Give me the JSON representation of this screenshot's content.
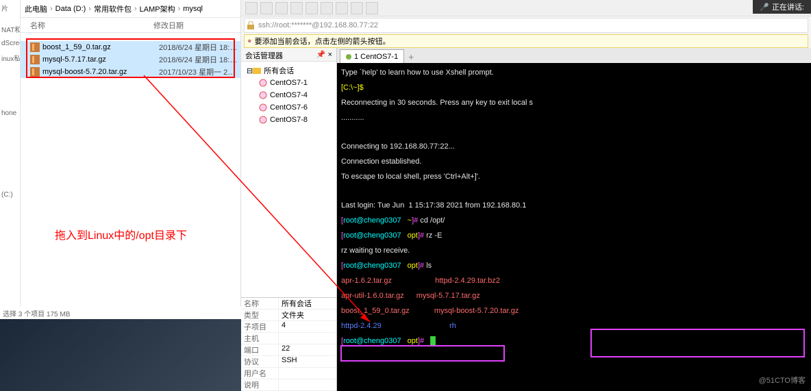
{
  "explorer": {
    "breadcrumb": [
      "此电脑",
      "Data (D:)",
      "常用软件包",
      "LAMP架构",
      "mysql"
    ],
    "header": {
      "name": "名称",
      "date": "修改日期"
    },
    "sidebar_items": [
      "片",
      "NAT和I",
      "dScree",
      "inux私房",
      "",
      "",
      "",
      "hone",
      "",
      "",
      "(C:)"
    ],
    "files": [
      {
        "name": "boost_1_59_0.tar.gz",
        "date": "2018/6/24 星期日 18:…"
      },
      {
        "name": "mysql-5.7.17.tar.gz",
        "date": "2018/6/24 星期日 18:…"
      },
      {
        "name": "mysql-boost-5.7.20.tar.gz",
        "date": "2017/10/23 星期一 2…"
      }
    ],
    "status": "选择 3 个项目  175 MB"
  },
  "annotation": "拖入到Linux中的/opt目录下",
  "xshell": {
    "address": "ssh://root:*******@192.168.80.77:22",
    "tip": "要添加当前会话，点击左侧的箭头按钮。",
    "session_mgr": "会话管理器",
    "tree_root": "所有会话",
    "tree_items": [
      "CentOS7-1",
      "CentOS7-4",
      "CentOS7-6",
      "CentOS7-8"
    ],
    "props": [
      {
        "k": "名称",
        "v": "所有会话"
      },
      {
        "k": "类型",
        "v": "文件夹"
      },
      {
        "k": "子项目",
        "v": "4"
      },
      {
        "k": "主机",
        "v": ""
      },
      {
        "k": "端口",
        "v": "22"
      },
      {
        "k": "协议",
        "v": "SSH"
      },
      {
        "k": "用户名",
        "v": ""
      },
      {
        "k": "说明",
        "v": ""
      }
    ],
    "tab_label": "1 CentOS7-1",
    "speaker": "正在讲话:"
  },
  "terminal": {
    "line1": "Type `help' to learn how to use Xshell prompt.",
    "prompt_c": "[C:\\~]$",
    "line2": "Reconnecting in 30 seconds. Press any key to exit local s",
    "dots": "...........",
    "line3": "Connecting to 192.168.80.77:22...",
    "line4": "Connection established.",
    "line5": "To escape to local shell, press 'Ctrl+Alt+]'.",
    "line6": "Last login: Tue Jun  1 15:17:38 2021 from 192.168.80.1",
    "prompt_tilde": "[root@cheng0307 ~]#",
    "cmd1": " cd /opt/",
    "prompt_opt": "[root@cheng0307 opt]#",
    "cmd2": " rz -E",
    "rz": "rz waiting to receive.",
    "cmd3": " ls",
    "ls": {
      "c1r1": "apr-1.6.2.tar.gz",
      "c2r1": "httpd-2.4.29.tar.bz2",
      "c1r2": "apr-util-1.6.0.tar.gz",
      "c2r2": "mysql-5.7.17.tar.gz",
      "c1r3": "boost_1_59_0.tar.gz",
      "c2r3": "mysql-boost-5.7.20.tar.gz",
      "c1r4": "httpd-2.4.29",
      "c2r4": "rh"
    }
  },
  "watermark": "@51CTO博客"
}
